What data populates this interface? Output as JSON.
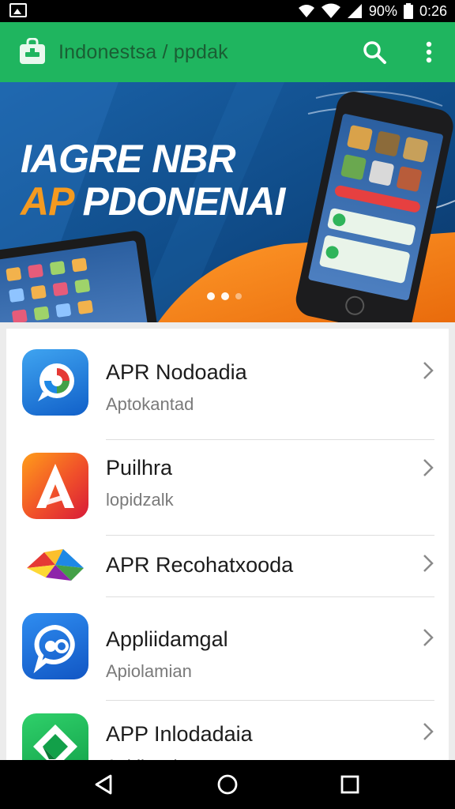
{
  "status_bar": {
    "battery_text": "90%",
    "time": "0:26"
  },
  "app_bar": {
    "title": "Indonestsa / ppdak"
  },
  "banner": {
    "line1": "IAGRE NBR",
    "line2_orange": "AP ",
    "line2_white": "PDONENAI",
    "page_count": 3,
    "active_page": 1
  },
  "apps": [
    {
      "title": "APR Nodoadia",
      "subtitle": "Aptokantad",
      "icon": "chat-bubble-icon"
    },
    {
      "title": "Puilhra",
      "subtitle": "lopidzalk",
      "icon": "letter-a-icon"
    },
    {
      "title": "APR Recohatxooda",
      "subtitle": "",
      "icon": "colorful-mountain-icon"
    },
    {
      "title": "Appliidamgal",
      "subtitle": "Apiolamian",
      "icon": "chat-dots-icon"
    },
    {
      "title": "APP Inlodadaia",
      "subtitle": "Anidkantion",
      "icon": "green-diamond-icon"
    }
  ],
  "colors": {
    "app_bar": "#1fb55f",
    "banner_orange": "#f49a20",
    "banner_blue": "#0f4d8c"
  }
}
